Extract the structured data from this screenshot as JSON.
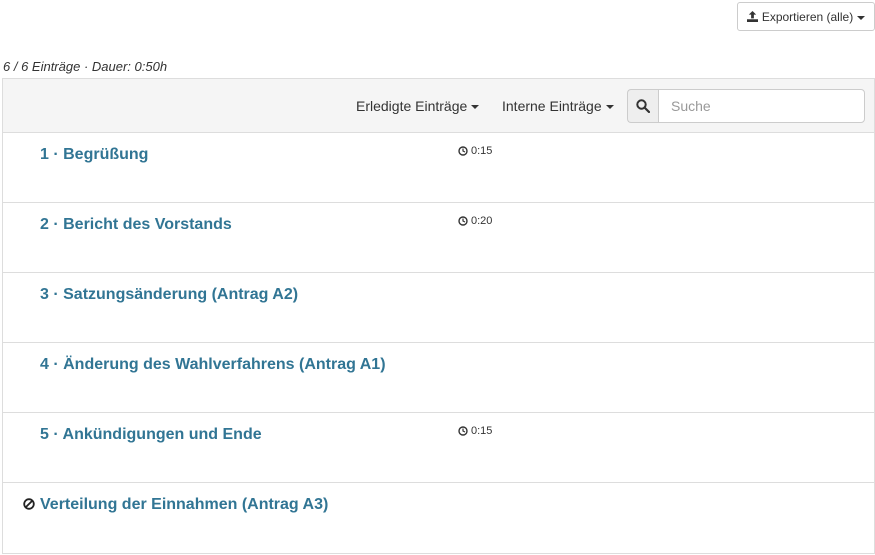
{
  "header": {
    "export_label": "Exportieren (alle)",
    "summary": "6 / 6 Einträge · Dauer: 0:50h"
  },
  "toolbar": {
    "filter_done_label": "Erledigte Einträge",
    "filter_internal_label": "Interne Einträge",
    "search_placeholder": "Suche"
  },
  "items": [
    {
      "title": "1 · Begrüßung",
      "duration": "0:15"
    },
    {
      "title": "2 · Bericht des Vorstands",
      "duration": "0:20"
    },
    {
      "title": "3 · Satzungsänderung (Antrag A2)",
      "duration": ""
    },
    {
      "title": "4 · Änderung des Wahlverfahrens (Antrag A1)",
      "duration": ""
    },
    {
      "title": "5 · Ankündigungen und Ende",
      "duration": "0:15"
    },
    {
      "title": "Verteilung der Einnahmen (Antrag A3)",
      "duration": "",
      "internal": true
    }
  ],
  "colors": {
    "link": "#317594",
    "toolbar_bg": "#f5f5f5",
    "border": "#dddddd"
  },
  "icons": {
    "export": "upload-icon",
    "search": "search-icon",
    "duration": "clock-icon",
    "internal": "ban-icon"
  }
}
